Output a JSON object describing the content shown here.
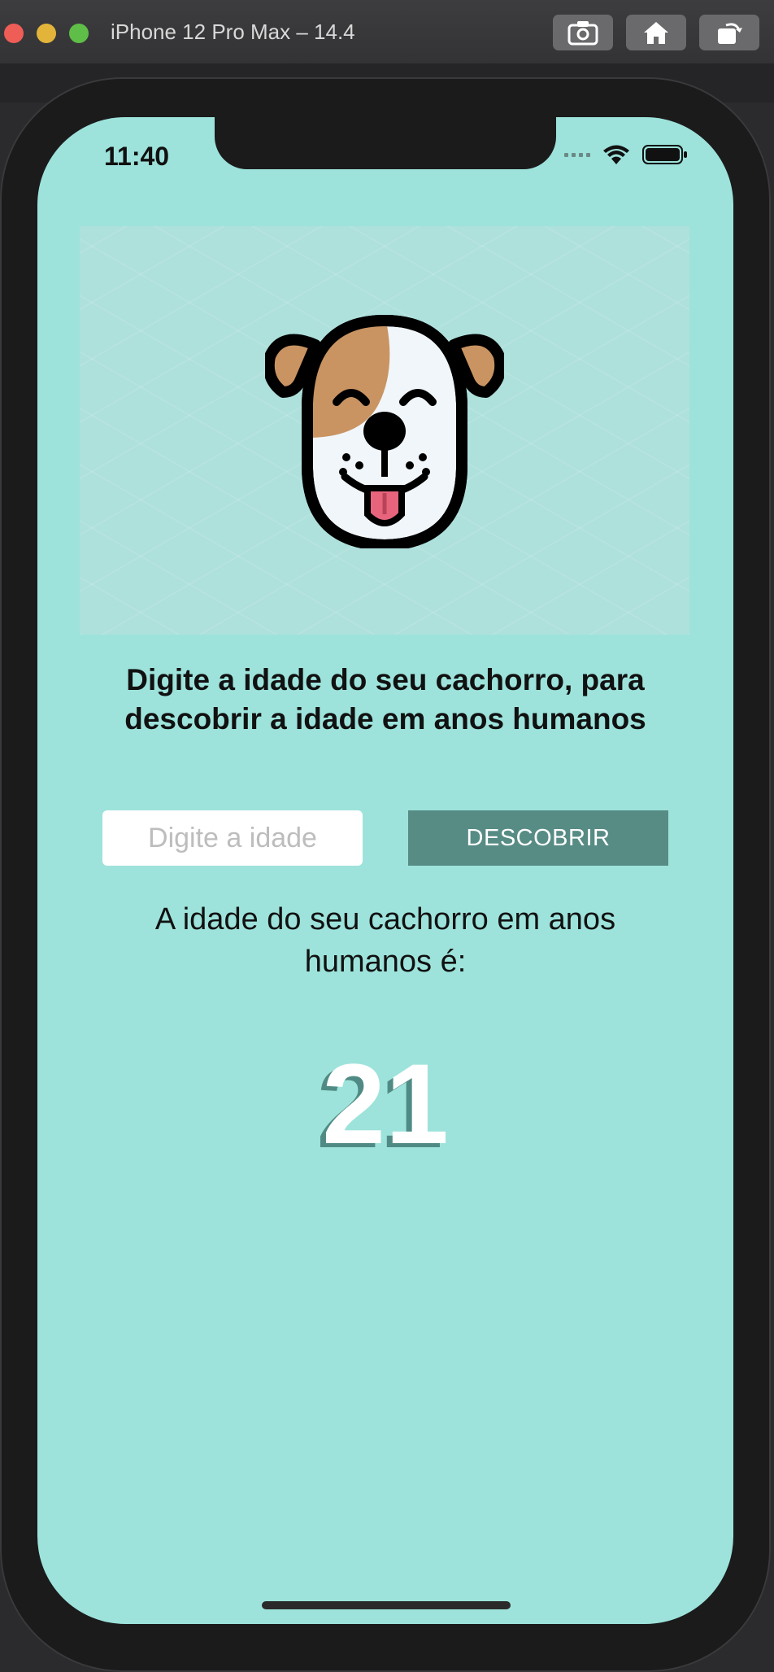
{
  "window": {
    "title": "iPhone 12 Pro Max – 14.4",
    "buttons": [
      "screenshot-icon",
      "home-icon",
      "rotate-icon"
    ]
  },
  "status_bar": {
    "time": "11:40",
    "icons": [
      "signal-icon",
      "wifi-icon",
      "battery-icon"
    ]
  },
  "app": {
    "prompt": "Digite a idade do seu cachorro, para descobrir a idade em anos humanos",
    "input": {
      "placeholder": "Digite a idade",
      "value": ""
    },
    "button_label": "DESCOBRIR",
    "result_label": "A idade do seu cachorro em anos humanos é:",
    "result_value": "21"
  },
  "colors": {
    "background": "#9de3db",
    "button": "#578c85",
    "result_shadow": "#4f8b84"
  }
}
